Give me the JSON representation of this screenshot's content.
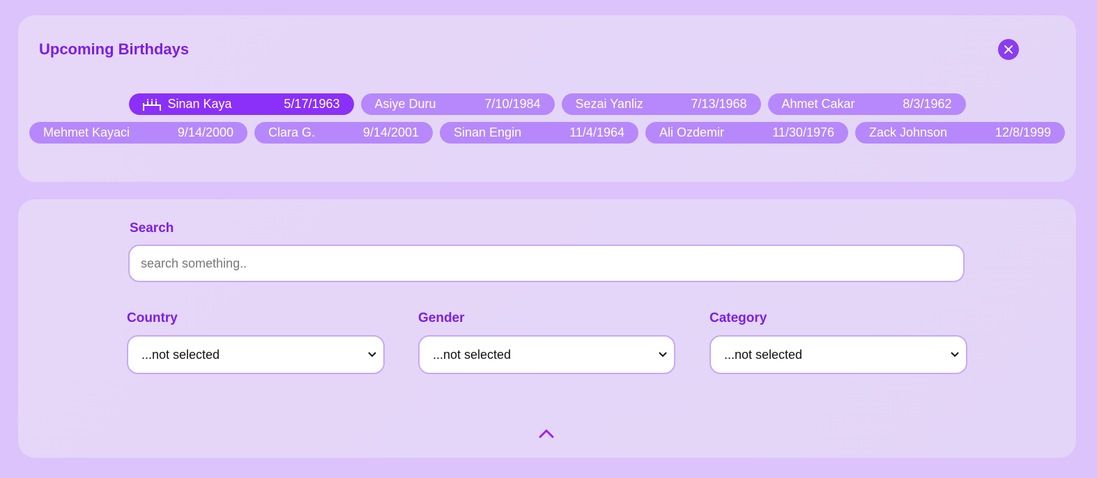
{
  "birthdays": {
    "title": "Upcoming Birthdays",
    "close_icon": "close-icon",
    "row1": [
      {
        "name": "Sinan Kaya",
        "date": "5/17/1963",
        "active": true
      },
      {
        "name": "Asiye Duru",
        "date": "7/10/1984"
      },
      {
        "name": "Sezai Yanliz",
        "date": "7/13/1968"
      },
      {
        "name": "Ahmet Cakar",
        "date": "8/3/1962"
      }
    ],
    "row2": [
      {
        "name": "Mehmet Kayaci",
        "date": "9/14/2000"
      },
      {
        "name": "Clara G.",
        "date": "9/14/2001"
      },
      {
        "name": "Sinan Engin",
        "date": "11/4/1964"
      },
      {
        "name": "Ali Ozdemir",
        "date": "11/30/1976"
      },
      {
        "name": "Zack Johnson",
        "date": "12/8/1999"
      }
    ]
  },
  "filters": {
    "search": {
      "label": "Search",
      "placeholder": "search something..",
      "value": ""
    },
    "country": {
      "label": "Country",
      "selected": "...not selected"
    },
    "gender": {
      "label": "Gender",
      "selected": "...not selected"
    },
    "category": {
      "label": "Category",
      "selected": "...not selected"
    },
    "collapse_icon": "chevron-up-icon"
  },
  "colors": {
    "background": "#dcc3fb",
    "accent": "#7b1ee8",
    "chip": "#b688fb",
    "chip_active": "#8a30f9"
  }
}
